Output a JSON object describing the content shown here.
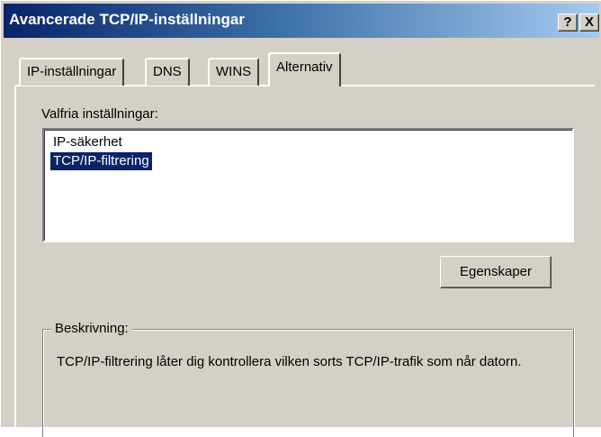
{
  "window": {
    "title": "Avancerade TCP/IP-inställningar",
    "help_label": "?",
    "close_label": "X"
  },
  "tabs": [
    {
      "label": "IP-inställningar"
    },
    {
      "label": "DNS"
    },
    {
      "label": "WINS"
    },
    {
      "label": "Alternativ",
      "active": true
    }
  ],
  "options": {
    "label": "Valfria inställningar:",
    "items": [
      {
        "label": "IP-säkerhet",
        "selected": false
      },
      {
        "label": "TCP/IP-filtrering",
        "selected": true
      }
    ]
  },
  "properties_button": "Egenskaper",
  "description": {
    "legend": "Beskrivning:",
    "text": "TCP/IP-filtrering låter dig kontrollera vilken sorts TCP/IP-trafik som når datorn."
  }
}
